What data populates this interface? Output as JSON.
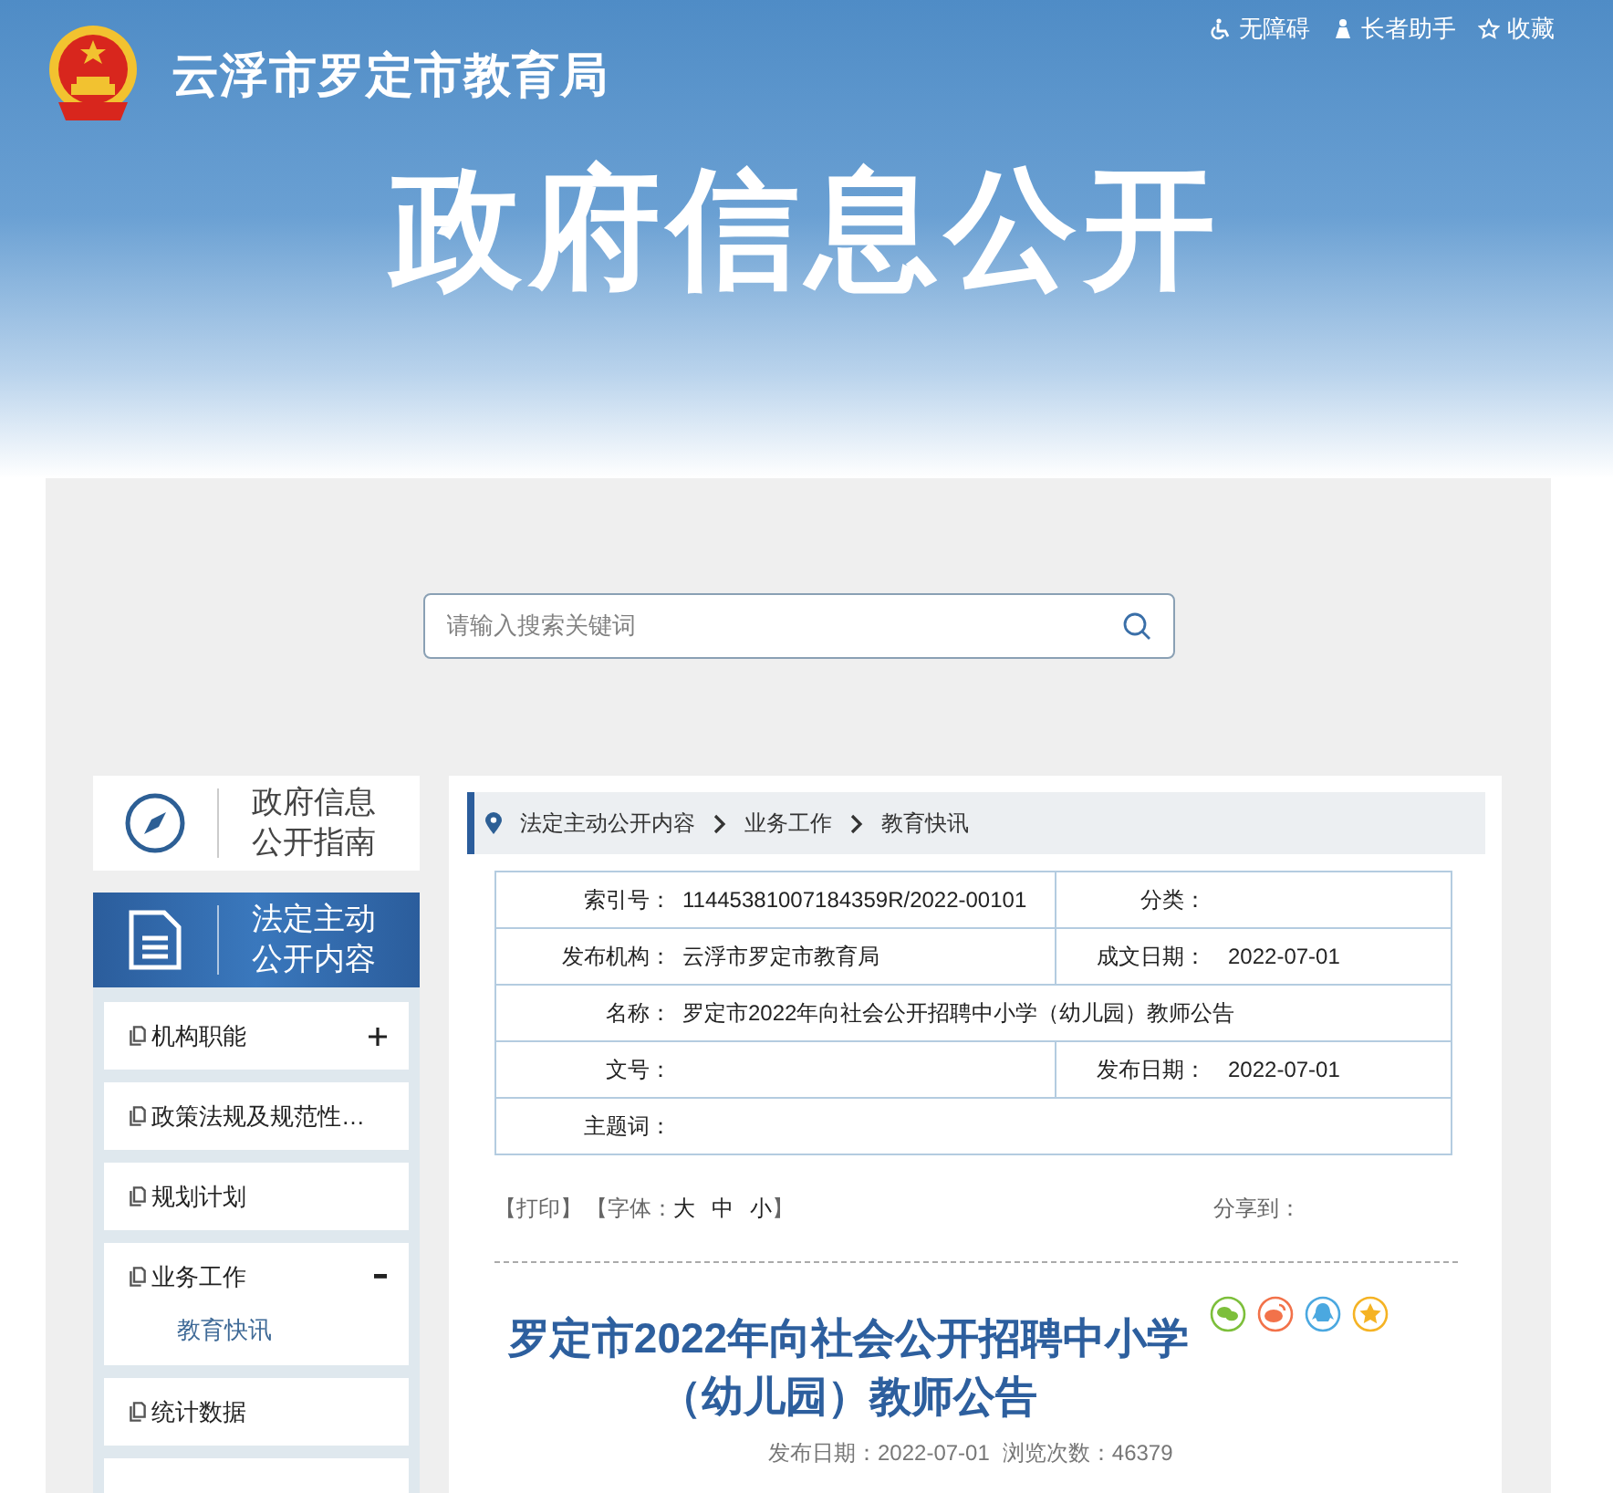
{
  "header": {
    "site_name": "云浮市罗定市教育局",
    "tools": [
      {
        "kind": "accessible",
        "label": "无障碍"
      },
      {
        "kind": "elder",
        "label": "长者助手"
      },
      {
        "kind": "favorite",
        "label": "收藏"
      }
    ],
    "banner_title": "政府信息公开"
  },
  "search": {
    "placeholder": "请输入搜索关键词"
  },
  "nav_cards": [
    {
      "kind": "guide",
      "label": "政府信息公开指南",
      "selected": false
    },
    {
      "kind": "content",
      "label": "法定主动公开内容",
      "selected": true
    }
  ],
  "menu": [
    {
      "kind": "group",
      "label": "机构职能",
      "expanded": false
    },
    {
      "kind": "link",
      "label": "政策法规及规范性…"
    },
    {
      "kind": "link",
      "label": "规划计划"
    },
    {
      "kind": "group",
      "label": "业务工作",
      "expanded": true,
      "children": [
        {
          "label": "教育快讯"
        }
      ]
    },
    {
      "kind": "link",
      "label": "统计数据"
    },
    {
      "kind": "link"
    }
  ],
  "breadcrumb": [
    "法定主动公开内容",
    "业务工作",
    "教育快讯"
  ],
  "meta_rows": [
    {
      "cells": [
        {
          "label": "索引号：",
          "value": "11445381007184359R/2022-00101"
        },
        {
          "label": "分类："
        }
      ]
    },
    {
      "cells": [
        {
          "label": "发布机构：",
          "value": "云浮市罗定市教育局"
        },
        {
          "label": "成文日期：",
          "value": "2022-07-01"
        }
      ]
    },
    {
      "cells": [
        {
          "label": "名称：",
          "value": "罗定市2022年向社会公开招聘中小学（幼儿园）教师公告"
        }
      ]
    },
    {
      "cells": [
        {
          "label": "文号："
        },
        {
          "label": "发布日期：",
          "value": "2022-07-01"
        }
      ]
    },
    {
      "cells": [
        {
          "label": "主题词："
        }
      ]
    }
  ],
  "tools": {
    "print": "【打印】",
    "font_open": "【字体：",
    "font_sizes": [
      "大",
      "中",
      "小"
    ],
    "font_close": "】",
    "share_label": "分享到："
  },
  "share": [
    {
      "kind": "wechat",
      "color": "#7dbf3b"
    },
    {
      "kind": "weibo",
      "color": "#f2724a"
    },
    {
      "kind": "qq",
      "color": "#4ba8e0"
    },
    {
      "kind": "favorite",
      "color": "#f5b324"
    }
  ],
  "article": {
    "title": "罗定市2022年向社会公开招聘中小学（幼儿园）教师公告",
    "published": "发布日期：2022-07-01",
    "views": "浏览次数：46379"
  }
}
